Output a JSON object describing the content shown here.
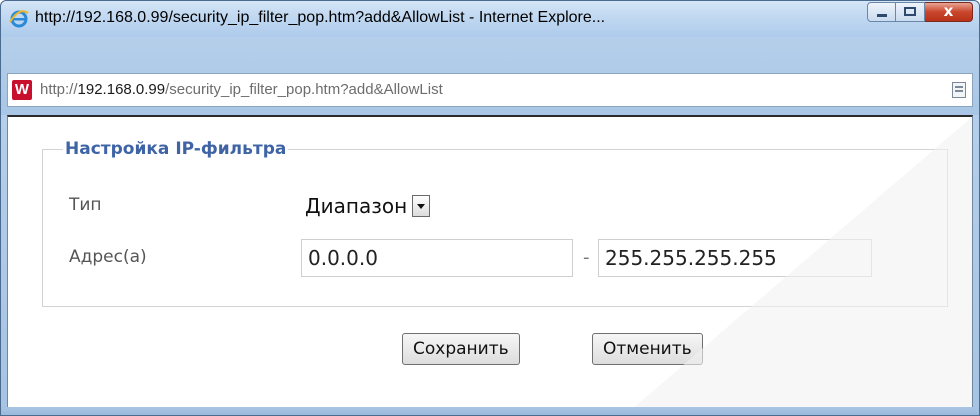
{
  "window": {
    "title": "http://192.168.0.99/security_ip_filter_pop.htm?add&AllowList - Internet Explore...",
    "close_label": "x"
  },
  "address": {
    "url_prefix": "http://",
    "url_host": "192.168.0.99",
    "url_path": "/security_ip_filter_pop.htm?add&AllowList",
    "site_icon_letter": "W"
  },
  "form": {
    "legend": "Настройка IP-фильтра",
    "type_label": "Тип",
    "type_value": "Диапазон",
    "address_label": "Адрес(а)",
    "ip_from": "0.0.0.0",
    "separator": "-",
    "ip_to": "255.255.255.255"
  },
  "buttons": {
    "save": "Сохранить",
    "cancel": "Отменить"
  },
  "colors": {
    "legend": "#3f64a6",
    "close_button": "#c9452b"
  }
}
